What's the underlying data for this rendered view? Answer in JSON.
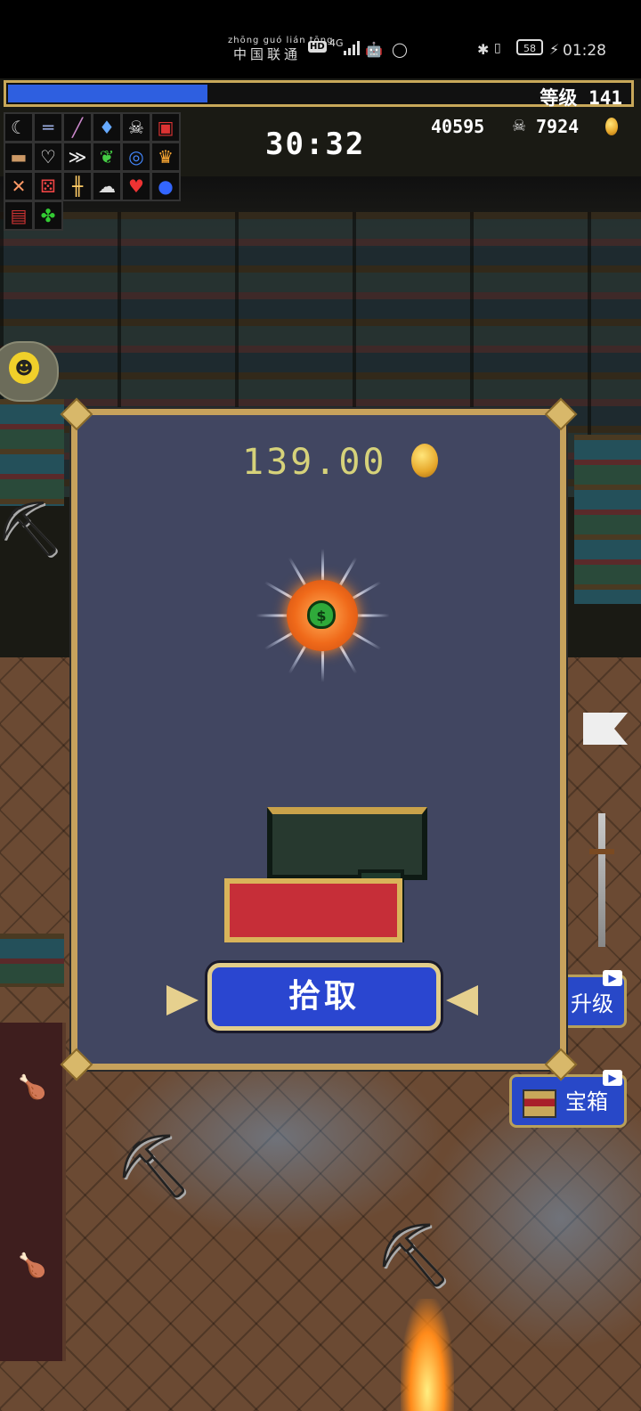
{
  "status_bar": {
    "carrier_pinyin": "zhōng guó lián tōng",
    "carrier_name": "中国联通",
    "hd_badge": "HD",
    "network": "4G",
    "battery": "58",
    "time": "01:28"
  },
  "hud": {
    "level_label": "等级 141",
    "xp_progress": 0.32,
    "timer": "30:32",
    "kills": "40595",
    "gold": "7924",
    "weapon_icons": [
      "whip-icon",
      "knife-icon",
      "wand-icon",
      "potion-icon",
      "skull-icon",
      "tome-icon",
      "bread-icon",
      "heart-outline-icon",
      "wings-icon",
      "feather-icon",
      "ring-icon",
      "crown-icon",
      "crossed-swords-icon",
      "dice-icon",
      "candelabra-icon",
      "clouds-icon",
      "heart-icon",
      "orb-icon",
      "armor-icon",
      "clover-icon"
    ]
  },
  "dialog": {
    "reward_amount": "139.00",
    "pickup_label": "拾取"
  },
  "side_buttons": {
    "upgrade_label": "升级",
    "chest_label": "宝箱"
  },
  "colors": {
    "xp_fill": "#2e5fe0",
    "dialog_bg": "#414661",
    "dialog_border": "#c7a25c",
    "button_blue": "#2a46d0",
    "reward_text": "#d6d27a"
  }
}
